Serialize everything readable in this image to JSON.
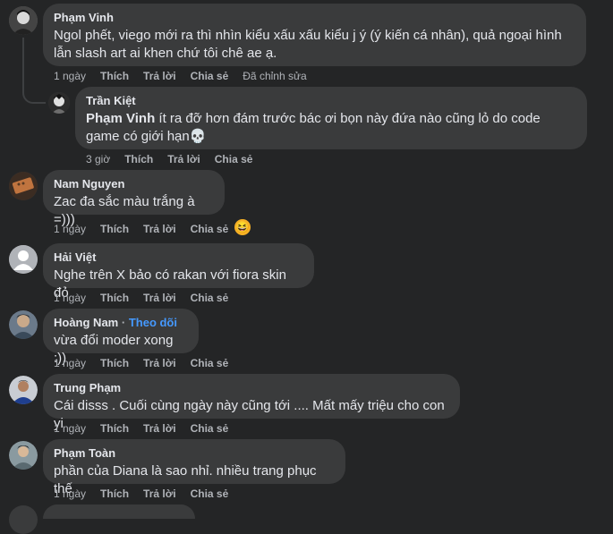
{
  "comments": [
    {
      "author": "Phạm Vinh",
      "text": "Ngol phết, viego mới ra thì nhìn kiểu xấu xấu kiểu j ý (ý kiến cá nhân), quả ngoại hình lẫn slash art ai khen chứ tôi chê ae ạ.",
      "time": "1 ngày",
      "like": "Thích",
      "reply": "Trả lời",
      "share": "Chia sẻ",
      "edited": "Đã chỉnh sửa"
    },
    {
      "author": "Trần Kiệt",
      "mention": "Phạm Vinh",
      "text": " ít ra đỡ hơn đám trước bác ơi bọn này đứa nào cũng lỏ do code game có giới hạn💀",
      "time": "3 giờ",
      "like": "Thích",
      "reply": "Trả lời",
      "share": "Chia sẻ"
    },
    {
      "author": "Nam Nguyen",
      "text": "Zac đa sắc màu trắng à =)))",
      "time": "1 ngày",
      "like": "Thích",
      "reply": "Trả lời",
      "share": "Chia sẻ",
      "reaction": "😆"
    },
    {
      "author": "Hải Việt",
      "text": "Nghe trên X bảo có rakan với fiora skin đỏ",
      "time": "1 ngày",
      "like": "Thích",
      "reply": "Trả lời",
      "share": "Chia sẻ"
    },
    {
      "author": "Hoàng Nam",
      "follow": "Theo dõi",
      "text": "vừa đổi moder xong :))",
      "time": "1 ngày",
      "like": "Thích",
      "reply": "Trả lời",
      "share": "Chia sẻ"
    },
    {
      "author": "Trung Phạm",
      "text": "Cái disss . Cuối cùng ngày này cũng tới .... Mất mấy triệu cho con yi",
      "time": "1 ngày",
      "like": "Thích",
      "reply": "Trả lời",
      "share": "Chia sẻ"
    },
    {
      "author": "Phạm Toàn",
      "text": "phần của Diana là sao nhỉ. nhiều trang phục thế",
      "time": "1 ngày",
      "like": "Thích",
      "reply": "Trả lời",
      "share": "Chia sẻ"
    }
  ]
}
